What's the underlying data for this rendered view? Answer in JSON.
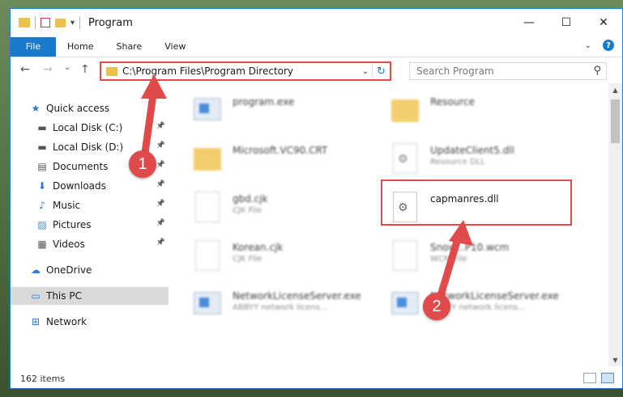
{
  "window": {
    "title": "Program",
    "controls": {
      "minimize": "—",
      "maximize": "☐",
      "close": "✕"
    }
  },
  "ribbon": {
    "tabs": [
      "File",
      "Home",
      "Share",
      "View"
    ],
    "help": "?"
  },
  "nav": {
    "back": "←",
    "forward": "→",
    "recent": "⌄",
    "up": "↑"
  },
  "address": {
    "path": "C:\\Program Files\\Program Directory",
    "dropdown": "⌄",
    "refresh": "↻"
  },
  "search": {
    "placeholder": "Search Program",
    "icon": "⚲"
  },
  "sidebar": {
    "items": [
      {
        "label": "Quick access",
        "icon": "star-icon",
        "glyph": "★",
        "color": "#2a7ad6",
        "pinned": false
      },
      {
        "label": "Local Disk (C:)",
        "icon": "drive-icon",
        "glyph": "▬",
        "color": "#555",
        "pinned": true
      },
      {
        "label": "Local Disk (D:)",
        "icon": "drive-icon",
        "glyph": "▬",
        "color": "#555",
        "pinned": true
      },
      {
        "label": "Documents",
        "icon": "documents-icon",
        "glyph": "▤",
        "color": "#555",
        "pinned": true
      },
      {
        "label": "Downloads",
        "icon": "download-icon",
        "glyph": "⬇",
        "color": "#2a7ad6",
        "pinned": true
      },
      {
        "label": "Music",
        "icon": "music-icon",
        "glyph": "♪",
        "color": "#2a7ad6",
        "pinned": true
      },
      {
        "label": "Pictures",
        "icon": "pictures-icon",
        "glyph": "▨",
        "color": "#4a8ac4",
        "pinned": true
      },
      {
        "label": "Videos",
        "icon": "videos-icon",
        "glyph": "▦",
        "color": "#555",
        "pinned": true
      },
      {
        "label": "OneDrive",
        "icon": "cloud-icon",
        "glyph": "☁",
        "color": "#2a7ad6",
        "pinned": false
      },
      {
        "label": "This PC",
        "icon": "computer-icon",
        "glyph": "▭",
        "color": "#2a7ad6",
        "pinned": false,
        "selected": true
      },
      {
        "label": "Network",
        "icon": "network-icon",
        "glyph": "⊞",
        "color": "#2a7ad6",
        "pinned": false
      }
    ]
  },
  "files": [
    {
      "name": "program.exe",
      "sub": "",
      "kind": "app"
    },
    {
      "name": "Resource",
      "sub": "",
      "kind": "folder"
    },
    {
      "name": "Microsoft.VC90.CRT",
      "sub": "",
      "kind": "folder"
    },
    {
      "name": "UpdateClient5.dll",
      "sub": "Resource DLL",
      "kind": "dll"
    },
    {
      "name": "gbd.cjk",
      "sub": "CJK File",
      "kind": "doc"
    },
    {
      "name": "capmanres.dll",
      "sub": "",
      "kind": "dll",
      "highlighted": true
    },
    {
      "name": "Korean.cjk",
      "sub": "CJK File",
      "kind": "doc"
    },
    {
      "name": "Snow...P10.wcm",
      "sub": "WCM File",
      "kind": "doc"
    },
    {
      "name": "NetworkLicenseServer.exe",
      "sub": "ABBYY network licens...",
      "kind": "app"
    },
    {
      "name": "NetworkLicenseServer.exe",
      "sub": "ABBYY network licens...",
      "kind": "app"
    }
  ],
  "status": {
    "count": "162 items"
  },
  "annotations": {
    "step1": "1",
    "step2": "2",
    "color": "#e04a4a"
  }
}
